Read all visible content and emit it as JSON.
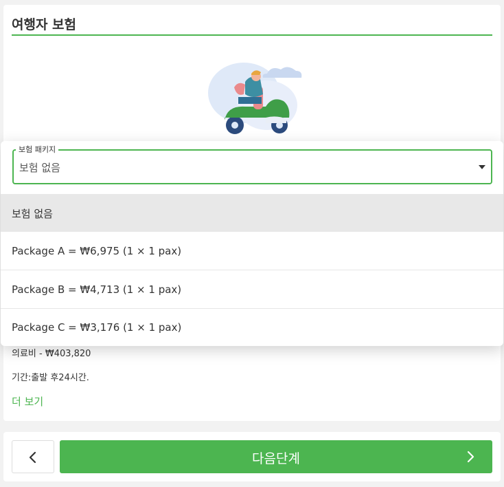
{
  "card": {
    "title": "여행자 보험",
    "illustration_icon": "scooter-rider-illustration",
    "details": [
      "의료비 - ₩403,820",
      "기간:출발 후24시간."
    ],
    "more_link": "더 보기"
  },
  "package_select": {
    "legend": "보험 패키지",
    "value": "보험 없음",
    "options": [
      "보험 없음",
      "Package A = ₩6,975 (1 × 1 pax)",
      "Package B = ₩4,713 (1 × 1 pax)",
      "Package C = ₩3,176 (1 × 1 pax)"
    ]
  },
  "footer": {
    "back_icon": "chevron-left-icon",
    "next_label": "다음단계",
    "next_icon": "chevron-right-icon"
  },
  "colors": {
    "accent": "#4cb550",
    "selected_option_bg": "#e8e8e8"
  }
}
